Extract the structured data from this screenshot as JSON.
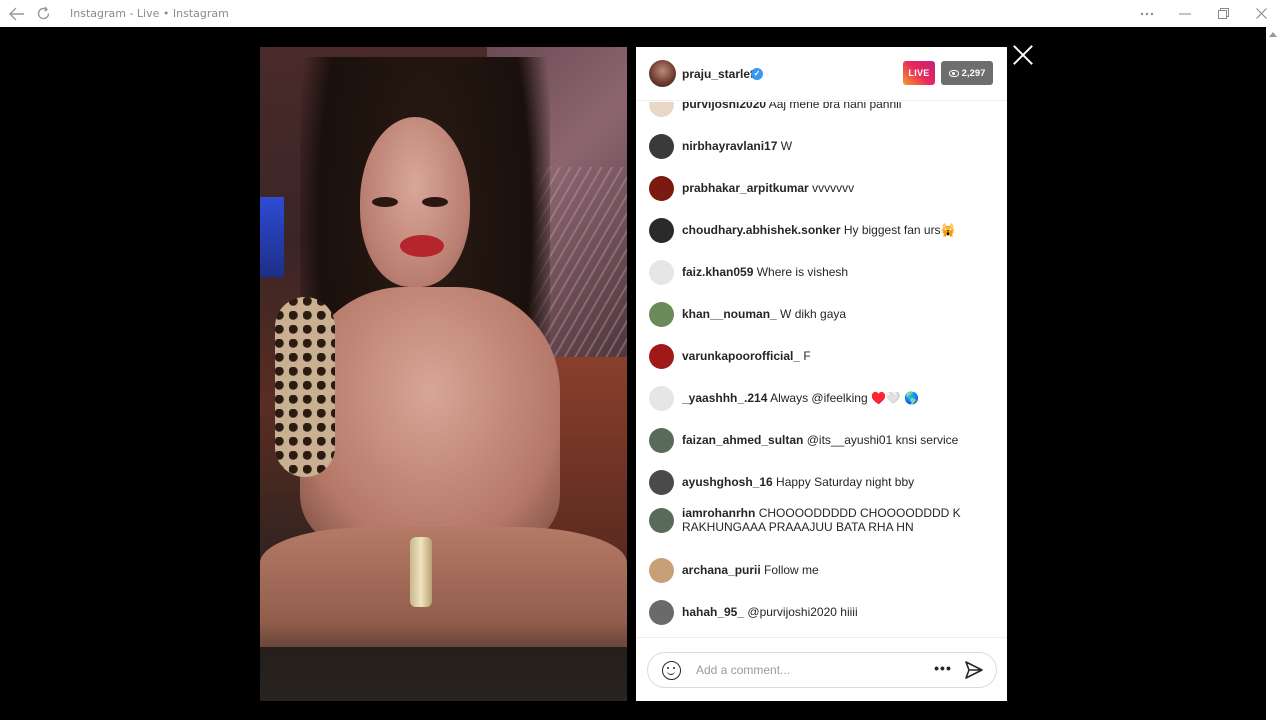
{
  "window": {
    "title": "Instagram - Live • Instagram",
    "back_icon": "back-arrow-icon",
    "reload_icon": "reload-icon",
    "controls": [
      "more-icon",
      "minimize-icon",
      "maximize-icon",
      "close-icon"
    ]
  },
  "live": {
    "host_username": "praju_starlet",
    "verified": true,
    "live_label": "LIVE",
    "viewer_count": "2,297"
  },
  "comments": [
    {
      "user": "purvijoshi2020",
      "text": "Aaj mene bra nahi pahnii",
      "avatar_color": "#e9d8c8"
    },
    {
      "user": "nirbhayravlani17",
      "text": "W",
      "avatar_color": "#3a3a3a"
    },
    {
      "user": "prabhakar_arpitkumar",
      "text": "vvvvvvv",
      "avatar_color": "#7a1a10"
    },
    {
      "user": "choudhary.abhishek.sonker",
      "text": "Hy biggest fan urs🙀",
      "avatar_color": "#2a2a2a"
    },
    {
      "user": "faiz.khan059",
      "text": "Where is vishesh",
      "avatar_color": "#e6e6e6"
    },
    {
      "user": "khan__nouman_",
      "text": "W dikh gaya",
      "avatar_color": "#6a8a5a"
    },
    {
      "user": "varunkapoorofficial_",
      "text": "F",
      "avatar_color": "#a01818"
    },
    {
      "user": "_yaashhh_.214",
      "text": "Always @ifeelking ♥️🤍 🌎",
      "avatar_color": "#e6e6e6"
    },
    {
      "user": "faizan_ahmed_sultan",
      "text": "@its__ayushi01 knsi service",
      "avatar_color": "#5a6a5a"
    },
    {
      "user": "ayushghosh_16",
      "text": "Happy Saturday night bby",
      "avatar_color": "#4a4a4a"
    },
    {
      "user": "iamrohanrhn",
      "text": "CHOOOODDDDD CHOOOODDDD K RAKHUNGAAA PRAAAJUU BATA RHA HN",
      "avatar_color": "#5a6a5a"
    },
    {
      "user": "archana_purii",
      "text": "Follow me",
      "avatar_color": "#c8a078"
    },
    {
      "user": "hahah_95_",
      "text": "@purvijoshi2020 hiiii",
      "avatar_color": "#6a6a6a"
    }
  ],
  "composer": {
    "placeholder": "Add a comment...",
    "emoji_icon": "emoji-icon",
    "more_icon": "more-options-icon",
    "send_icon": "send-icon"
  }
}
